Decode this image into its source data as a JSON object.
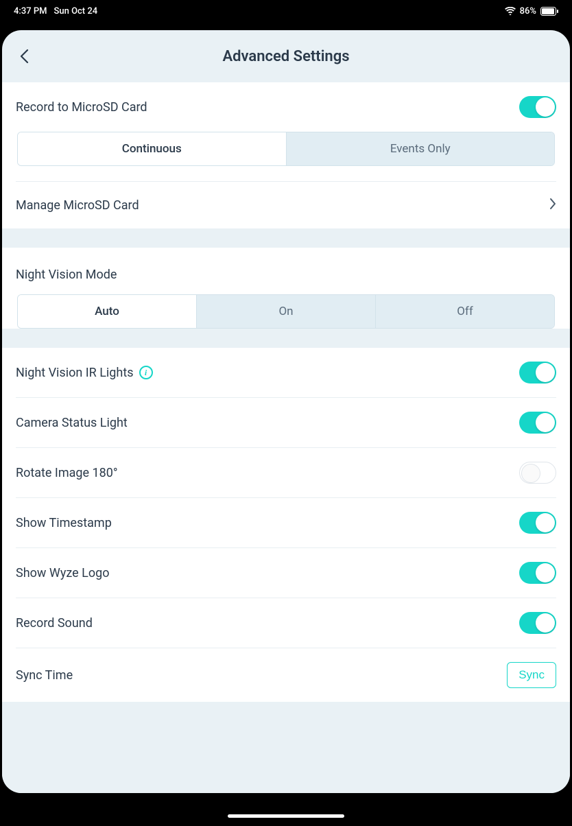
{
  "status": {
    "time": "4:37 PM",
    "date": "Sun Oct 24",
    "battery": "86%"
  },
  "header": {
    "title": "Advanced Settings"
  },
  "recording": {
    "label": "Record to MicroSD Card",
    "segments": {
      "continuous": "Continuous",
      "events_only": "Events Only"
    },
    "manage_label": "Manage MicroSD Card"
  },
  "night_vision": {
    "label": "Night Vision Mode",
    "segments": {
      "auto": "Auto",
      "on": "On",
      "off": "Off"
    }
  },
  "toggles": {
    "ir_lights": "Night Vision IR Lights",
    "status_light": "Camera Status Light",
    "rotate": "Rotate Image 180°",
    "timestamp": "Show Timestamp",
    "logo": "Show Wyze Logo",
    "sound": "Record Sound",
    "sync_time_label": "Sync Time",
    "sync_button": "Sync"
  }
}
